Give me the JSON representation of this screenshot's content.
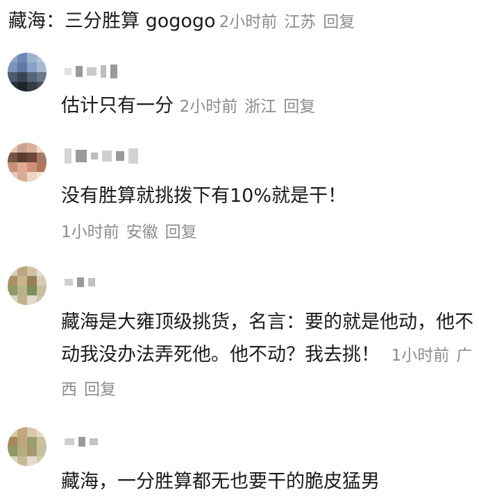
{
  "top": {
    "author": "藏海：",
    "content": "三分胜算 gogogo",
    "time": "2小时前",
    "location": "江苏",
    "reply": "回复"
  },
  "comments": [
    {
      "text": "估计只有一分",
      "time": "2小时前",
      "location": "浙江",
      "reply": "回复"
    },
    {
      "text": "没有胜算就挑拨下有10%就是干！",
      "time": "1小时前",
      "location": "安徽",
      "reply": "回复"
    },
    {
      "text": "藏海是大雍顶级挑货，名言：要的就是他动，他不动我没办法弄死他。他不动？我去挑！",
      "time": "1小时前",
      "location": "广西",
      "reply": "回复"
    },
    {
      "text": "藏海，一分胜算都无也要干的脆皮猛男",
      "time": "",
      "location": "",
      "reply": ""
    }
  ],
  "colors": {
    "text": "#1a1a1a",
    "meta": "#8c8c8c",
    "blur": "#c9c9c9"
  }
}
